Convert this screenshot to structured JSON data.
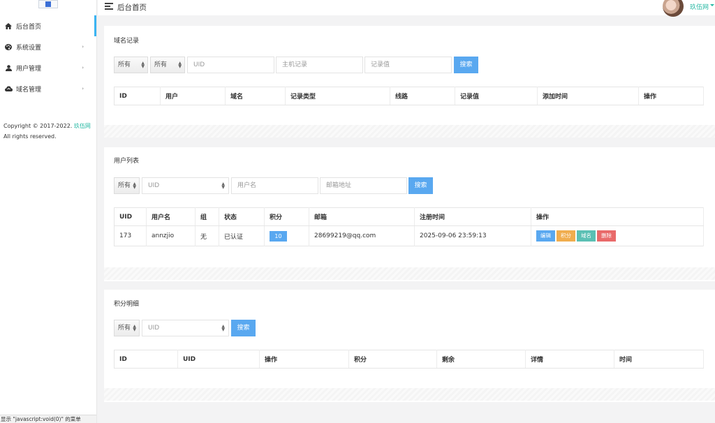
{
  "sidebar": {
    "items": [
      {
        "label": "后台首页",
        "icon": "home-icon"
      },
      {
        "label": "系统设置",
        "icon": "palette-icon"
      },
      {
        "label": "用户管理",
        "icon": "user-icon"
      },
      {
        "label": "域名管理",
        "icon": "cloud-icon"
      }
    ],
    "copyright_prefix": "Copyright © 2017-2022.",
    "copyright_link": "玖伍网",
    "copyright_suffix": " All rights reserved."
  },
  "header": {
    "title": "后台首页",
    "username": "玖伍网"
  },
  "domain_records": {
    "title": "域名记录",
    "filter1": "所有",
    "filter2": "所有",
    "uid_placeholder": "UID",
    "host_placeholder": "主机记录",
    "value_placeholder": "记录值",
    "search_label": "搜索",
    "columns": [
      "ID",
      "用户",
      "域名",
      "记录类型",
      "线路",
      "记录值",
      "添加时间",
      "操作"
    ]
  },
  "user_list": {
    "title": "用户列表",
    "filter": "所有",
    "uid_placeholder": "UID",
    "username_placeholder": "用户名",
    "email_placeholder": "邮箱地址",
    "search_label": "搜索",
    "columns": [
      "UID",
      "用户名",
      "组",
      "状态",
      "积分",
      "邮箱",
      "注册时间",
      "操作"
    ],
    "rows": [
      {
        "uid": "173",
        "username": "annzjio",
        "group": "无",
        "status": "已认证",
        "score": "10",
        "email": "28699219@qq.com",
        "registered": "2025-09-06 23:59:13",
        "actions": [
          "编辑",
          "积分",
          "域名",
          "删除"
        ]
      }
    ]
  },
  "points_detail": {
    "title": "积分明细",
    "filter": "所有",
    "uid_placeholder": "UID",
    "search_label": "搜索",
    "columns": [
      "ID",
      "UID",
      "操作",
      "积分",
      "剩余",
      "详情",
      "时间"
    ]
  },
  "status_bar": {
    "text": "显示 \"javascript:void(0)\" 的菜单"
  },
  "colors": {
    "accent": "#59a8f0",
    "link": "#23b7a2",
    "edit": "#59a8f0",
    "points": "#f0ad4e",
    "domain": "#5bc0b4",
    "delete": "#e96a6a"
  }
}
